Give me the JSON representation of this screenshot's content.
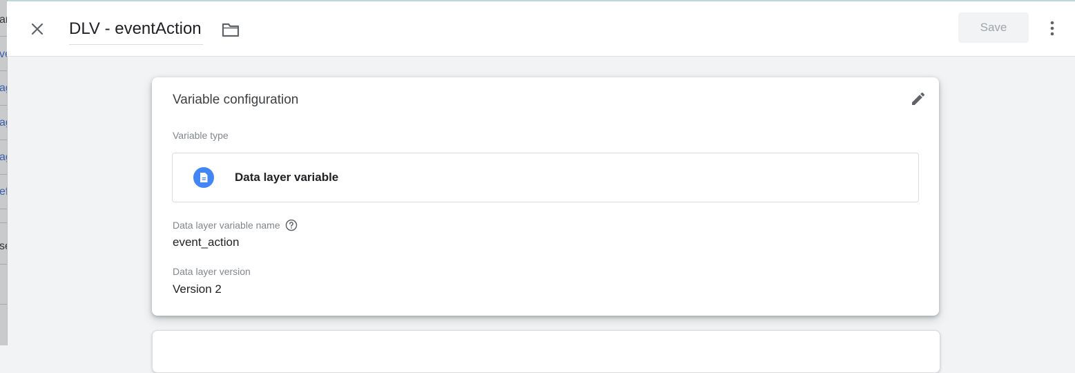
{
  "background_fragments": [
    "ar",
    "ve",
    "ag",
    "ag",
    "ag",
    "ef",
    "se"
  ],
  "header": {
    "title": "DLV - eventAction",
    "save_label": "Save",
    "icons": {
      "close": "close-icon",
      "folder": "folder-icon",
      "more": "more-vert-icon"
    }
  },
  "card": {
    "title": "Variable configuration",
    "variable_type_label": "Variable type",
    "variable_type_value": "Data layer variable",
    "variable_type_icon": "document-icon",
    "name_label": "Data layer variable name",
    "name_value": "event_action",
    "version_label": "Data layer version",
    "version_value": "Version 2",
    "icons": {
      "edit": "pencil-icon",
      "help": "help-icon"
    }
  },
  "colors": {
    "accent": "#4285f4",
    "save_disabled_text": "#a0a4a8",
    "background": "#f1f3f4"
  }
}
